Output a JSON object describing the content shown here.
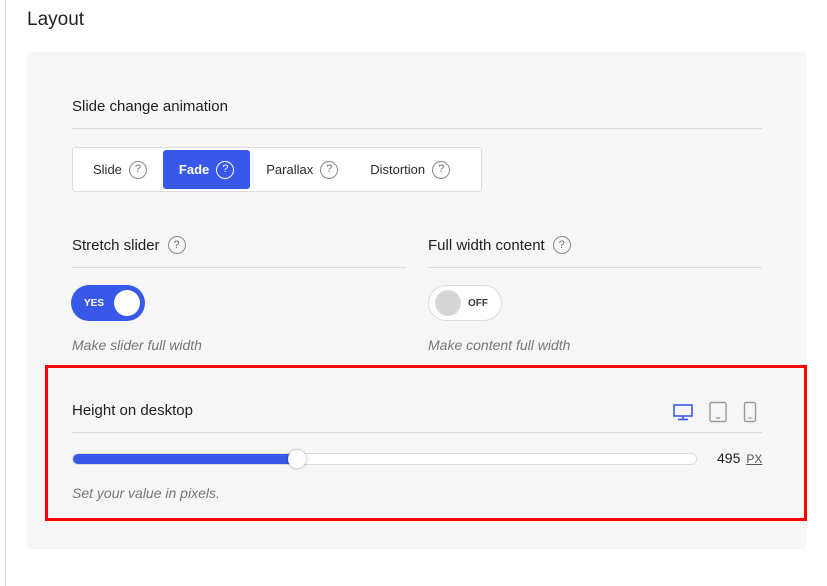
{
  "section": {
    "title": "Layout"
  },
  "animation": {
    "label": "Slide change animation",
    "options": [
      {
        "label": "Slide",
        "active": false
      },
      {
        "label": "Fade",
        "active": true
      },
      {
        "label": "Parallax",
        "active": false
      },
      {
        "label": "Distortion",
        "active": false
      }
    ]
  },
  "stretch": {
    "label": "Stretch slider",
    "toggle_label": "YES",
    "state": "on",
    "hint": "Make slider full width"
  },
  "fullwidth": {
    "label": "Full width content",
    "toggle_label": "OFF",
    "state": "off",
    "hint": "Make content full width"
  },
  "height": {
    "label": "Height on desktop",
    "devices": [
      "desktop-icon",
      "tablet-icon",
      "mobile-icon"
    ],
    "active_device": "desktop",
    "value": "495",
    "unit": "PX",
    "fill_fraction": 0.36,
    "hint": "Set your value in pixels."
  },
  "help_glyph": "?",
  "colors": {
    "accent": "#3858e9",
    "highlight": "#ff0000",
    "panel": "#f6f6f7",
    "muted_icon": "#9a9a9a"
  }
}
